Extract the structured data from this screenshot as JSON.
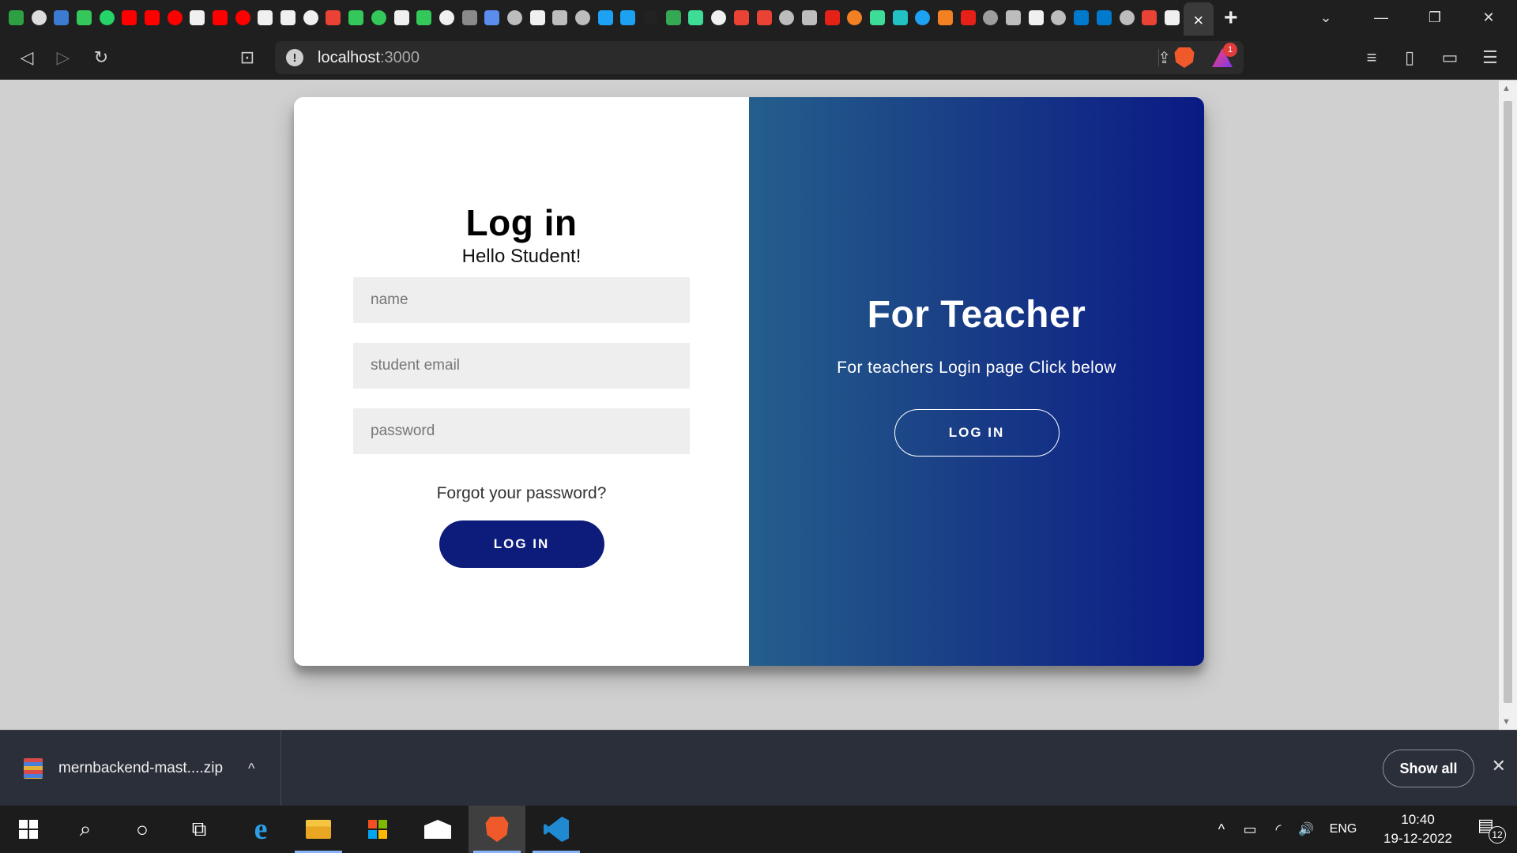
{
  "browser": {
    "tab_favicon_colors": [
      "#2ea043",
      "#dddddd",
      "#3b7bd1",
      "#34c759",
      "#25d366",
      "#ff0000",
      "#ff0000",
      "#ff0000",
      "#f0f0f0",
      "#ff0000",
      "#ff0000",
      "#f0f0f0",
      "#f0f0f0",
      "#f0f0f0",
      "#ea4335",
      "#34c759",
      "#34c759",
      "#f0f0f0",
      "#34c759",
      "#f0f0f0",
      "#8a8a8a",
      "#5b8def",
      "#bdbdbd",
      "#f0f0f0",
      "#bdbdbd",
      "#bdbdbd",
      "#1da1f2",
      "#1da1f2",
      "#222222",
      "#34a853",
      "#3ddc97",
      "#f0f0f0",
      "#ea4335",
      "#ea4335",
      "#bdbdbd",
      "#bdbdbd",
      "#e62117",
      "#f48024",
      "#3ddc97",
      "#22c1c3",
      "#1da1f2",
      "#f48024",
      "#e62117",
      "#9e9e9e",
      "#bdbdbd",
      "#f0f0f0",
      "#bdbdbd",
      "#007acc",
      "#007acc",
      "#bdbdbd",
      "#ea4335",
      "#f0f0f0"
    ],
    "active_tab_close": "×",
    "new_tab": "+",
    "window_controls": {
      "tab_search": "⌄",
      "minimize": "—",
      "restore": "❐",
      "close": "✕"
    },
    "nav": {
      "back": "◁",
      "forward": "▷",
      "reload": "↻",
      "bookmark": "⊡"
    },
    "url_host": "localhost",
    "url_port": ":3000",
    "rewards_badge": "1",
    "right_icons": {
      "playlist": "≡",
      "sidebar": "▯",
      "wallet": "▭",
      "menu": "☰"
    }
  },
  "page": {
    "login": {
      "title": "Log in",
      "subtitle": "Hello Student!",
      "name_placeholder": "name",
      "email_placeholder": "student email",
      "password_placeholder": "password",
      "forgot_label": "Forgot your password?",
      "button_label": "LOG IN"
    },
    "teacher": {
      "title": "For Teacher",
      "text": "For teachers Login page Click below",
      "button_label": "LOG IN"
    }
  },
  "downloads": {
    "file_name": "mernbackend-mast....zip",
    "chevron": "^",
    "show_all_label": "Show all",
    "close": "✕"
  },
  "taskbar": {
    "search": "⌕",
    "cortana": "○",
    "task_view": "⧉",
    "edge": "e",
    "tray_expand": "^",
    "battery": "▭",
    "wifi": "◜",
    "volume": "🔊",
    "language": "ENG",
    "time": "10:40",
    "date": "19-12-2022",
    "notification_count": "12",
    "accent_color": "#8ab4f8"
  }
}
